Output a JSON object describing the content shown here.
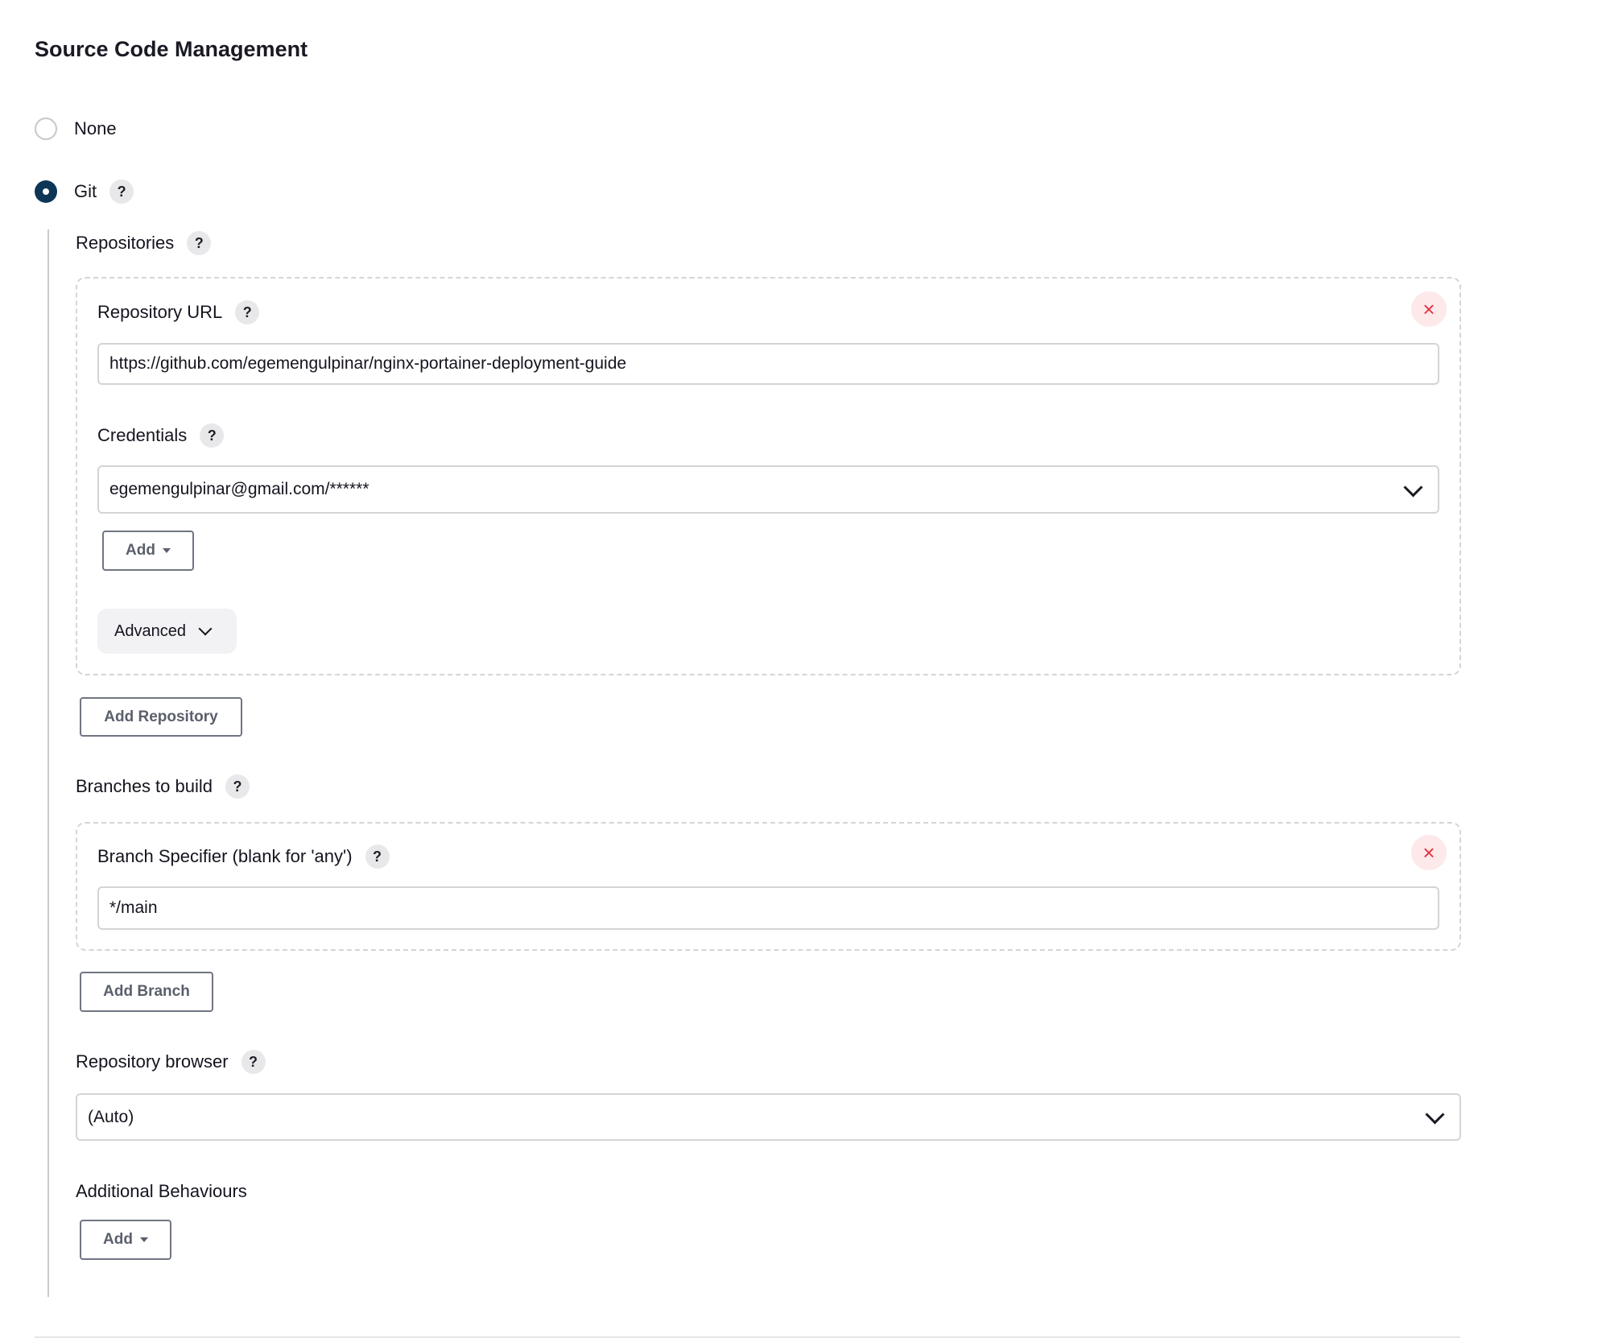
{
  "section": {
    "title": "Source Code Management"
  },
  "scm_options": [
    {
      "label": "None",
      "selected": false
    },
    {
      "label": "Git",
      "selected": true
    }
  ],
  "help_glyph": "?",
  "remove_glyph": "×",
  "repositories": {
    "label": "Repositories",
    "url_label": "Repository URL",
    "url_value": "https://github.com/egemengulpinar/nginx-portainer-deployment-guide",
    "credentials_label": "Credentials",
    "credentials_value": "egemengulpinar@gmail.com/******",
    "add_label": "Add",
    "advanced_label": "Advanced",
    "add_repository_label": "Add Repository"
  },
  "branches": {
    "label": "Branches to build",
    "specifier_label": "Branch Specifier (blank for 'any')",
    "specifier_value": "*/main",
    "add_branch_label": "Add Branch"
  },
  "repository_browser": {
    "label": "Repository browser",
    "value": "(Auto)"
  },
  "additional_behaviours": {
    "label": "Additional Behaviours",
    "add_label": "Add"
  },
  "colors": {
    "radio_selected": "#0d3656",
    "remove_red": "#e5323f",
    "remove_bg": "#fde8ea",
    "help_bg": "#e8e8ea"
  },
  "icons": [
    "help-icon",
    "close-icon",
    "chevron-down-icon",
    "caret-down-icon"
  ]
}
